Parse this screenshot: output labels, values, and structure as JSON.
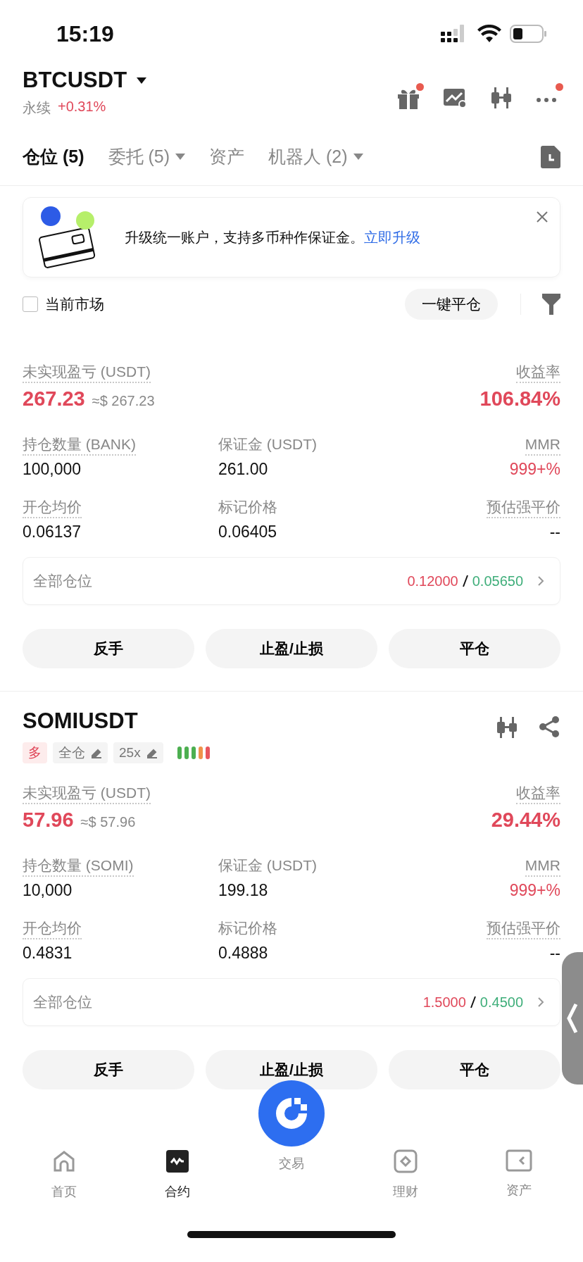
{
  "status_bar": {
    "time": "15:19"
  },
  "header": {
    "symbol": "BTCUSDT",
    "market": "永续",
    "change": "+0.31%",
    "actions": [
      {
        "kind": "gift",
        "badge": true
      },
      {
        "kind": "chart",
        "badge": false
      },
      {
        "kind": "candles",
        "badge": false
      },
      {
        "kind": "more",
        "badge": true
      }
    ]
  },
  "tabs": [
    {
      "label": "仓位 (5)",
      "selected": true,
      "dropdown": false
    },
    {
      "label": "委托 (5)",
      "selected": false,
      "dropdown": true
    },
    {
      "label": "资产",
      "selected": false,
      "dropdown": false
    },
    {
      "label": "机器人 (2)",
      "selected": false,
      "dropdown": true
    }
  ],
  "banner": {
    "text": "升级统一账户，支持多币种作保证金。",
    "link": "立即升级"
  },
  "filter": {
    "label": "当前市场",
    "checked": false,
    "close_all": "一键平仓"
  },
  "positions": [
    {
      "pnl_label": "未实现盈亏 (USDT)",
      "pnl": "267.23",
      "pnl_usd": "≈$ 267.23",
      "roe_label": "收益率",
      "roe": "106.84%",
      "fields": [
        {
          "label": "持仓数量 (BANK)",
          "value": "100,000",
          "dotted": true,
          "highlight": false
        },
        {
          "label": "保证金 (USDT)",
          "value": "261.00",
          "dotted": false,
          "highlight": false
        },
        {
          "label": "MMR",
          "value": "999+%",
          "dotted": true,
          "highlight": true
        },
        {
          "label": "开仓均价",
          "value": "0.06137",
          "dotted": true,
          "highlight": false
        },
        {
          "label": "标记价格",
          "value": "0.06405",
          "dotted": false,
          "highlight": false
        },
        {
          "label": "预估强平价",
          "value": "--",
          "dotted": true,
          "highlight": false
        }
      ],
      "all_positions": {
        "label": "全部仓位",
        "take_profit": "0.12000",
        "stop_loss": "0.05650"
      },
      "buttons": [
        "反手",
        "止盈/止损",
        "平仓"
      ]
    },
    {
      "symbol": "SOMIUSDT",
      "tags": [
        {
          "text": "多",
          "kind": "side"
        },
        {
          "text": "全仓",
          "kind": "editable"
        },
        {
          "text": "25x",
          "kind": "editable"
        }
      ],
      "risk_bars": [
        {
          "color": "#4caf50"
        },
        {
          "color": "#4caf50"
        },
        {
          "color": "#4caf50"
        },
        {
          "color": "#f0924a"
        },
        {
          "color": "#e8555d"
        }
      ],
      "pnl_label": "未实现盈亏 (USDT)",
      "pnl": "57.96",
      "pnl_usd": "≈$ 57.96",
      "roe_label": "收益率",
      "roe": "29.44%",
      "fields": [
        {
          "label": "持仓数量 (SOMI)",
          "value": "10,000",
          "dotted": true,
          "highlight": false
        },
        {
          "label": "保证金 (USDT)",
          "value": "199.18",
          "dotted": false,
          "highlight": false
        },
        {
          "label": "MMR",
          "value": "999+%",
          "dotted": true,
          "highlight": true
        },
        {
          "label": "开仓均价",
          "value": "0.4831",
          "dotted": true,
          "highlight": false
        },
        {
          "label": "标记价格",
          "value": "0.4888",
          "dotted": false,
          "highlight": false
        },
        {
          "label": "预估强平价",
          "value": "--",
          "dotted": true,
          "highlight": false
        }
      ],
      "all_positions": {
        "label": "全部仓位",
        "take_profit": "1.5000",
        "stop_loss": "0.4500"
      },
      "buttons": [
        "反手",
        "止盈/止损",
        "平仓"
      ]
    }
  ],
  "nav": [
    {
      "kind": "home",
      "label": "首页",
      "selected": false
    },
    {
      "kind": "futures",
      "label": "合约",
      "selected": true
    },
    {
      "kind": "trade",
      "label": "交易",
      "selected": false
    },
    {
      "kind": "earn",
      "label": "理财",
      "selected": false
    },
    {
      "kind": "assets",
      "label": "资产",
      "selected": false
    }
  ]
}
